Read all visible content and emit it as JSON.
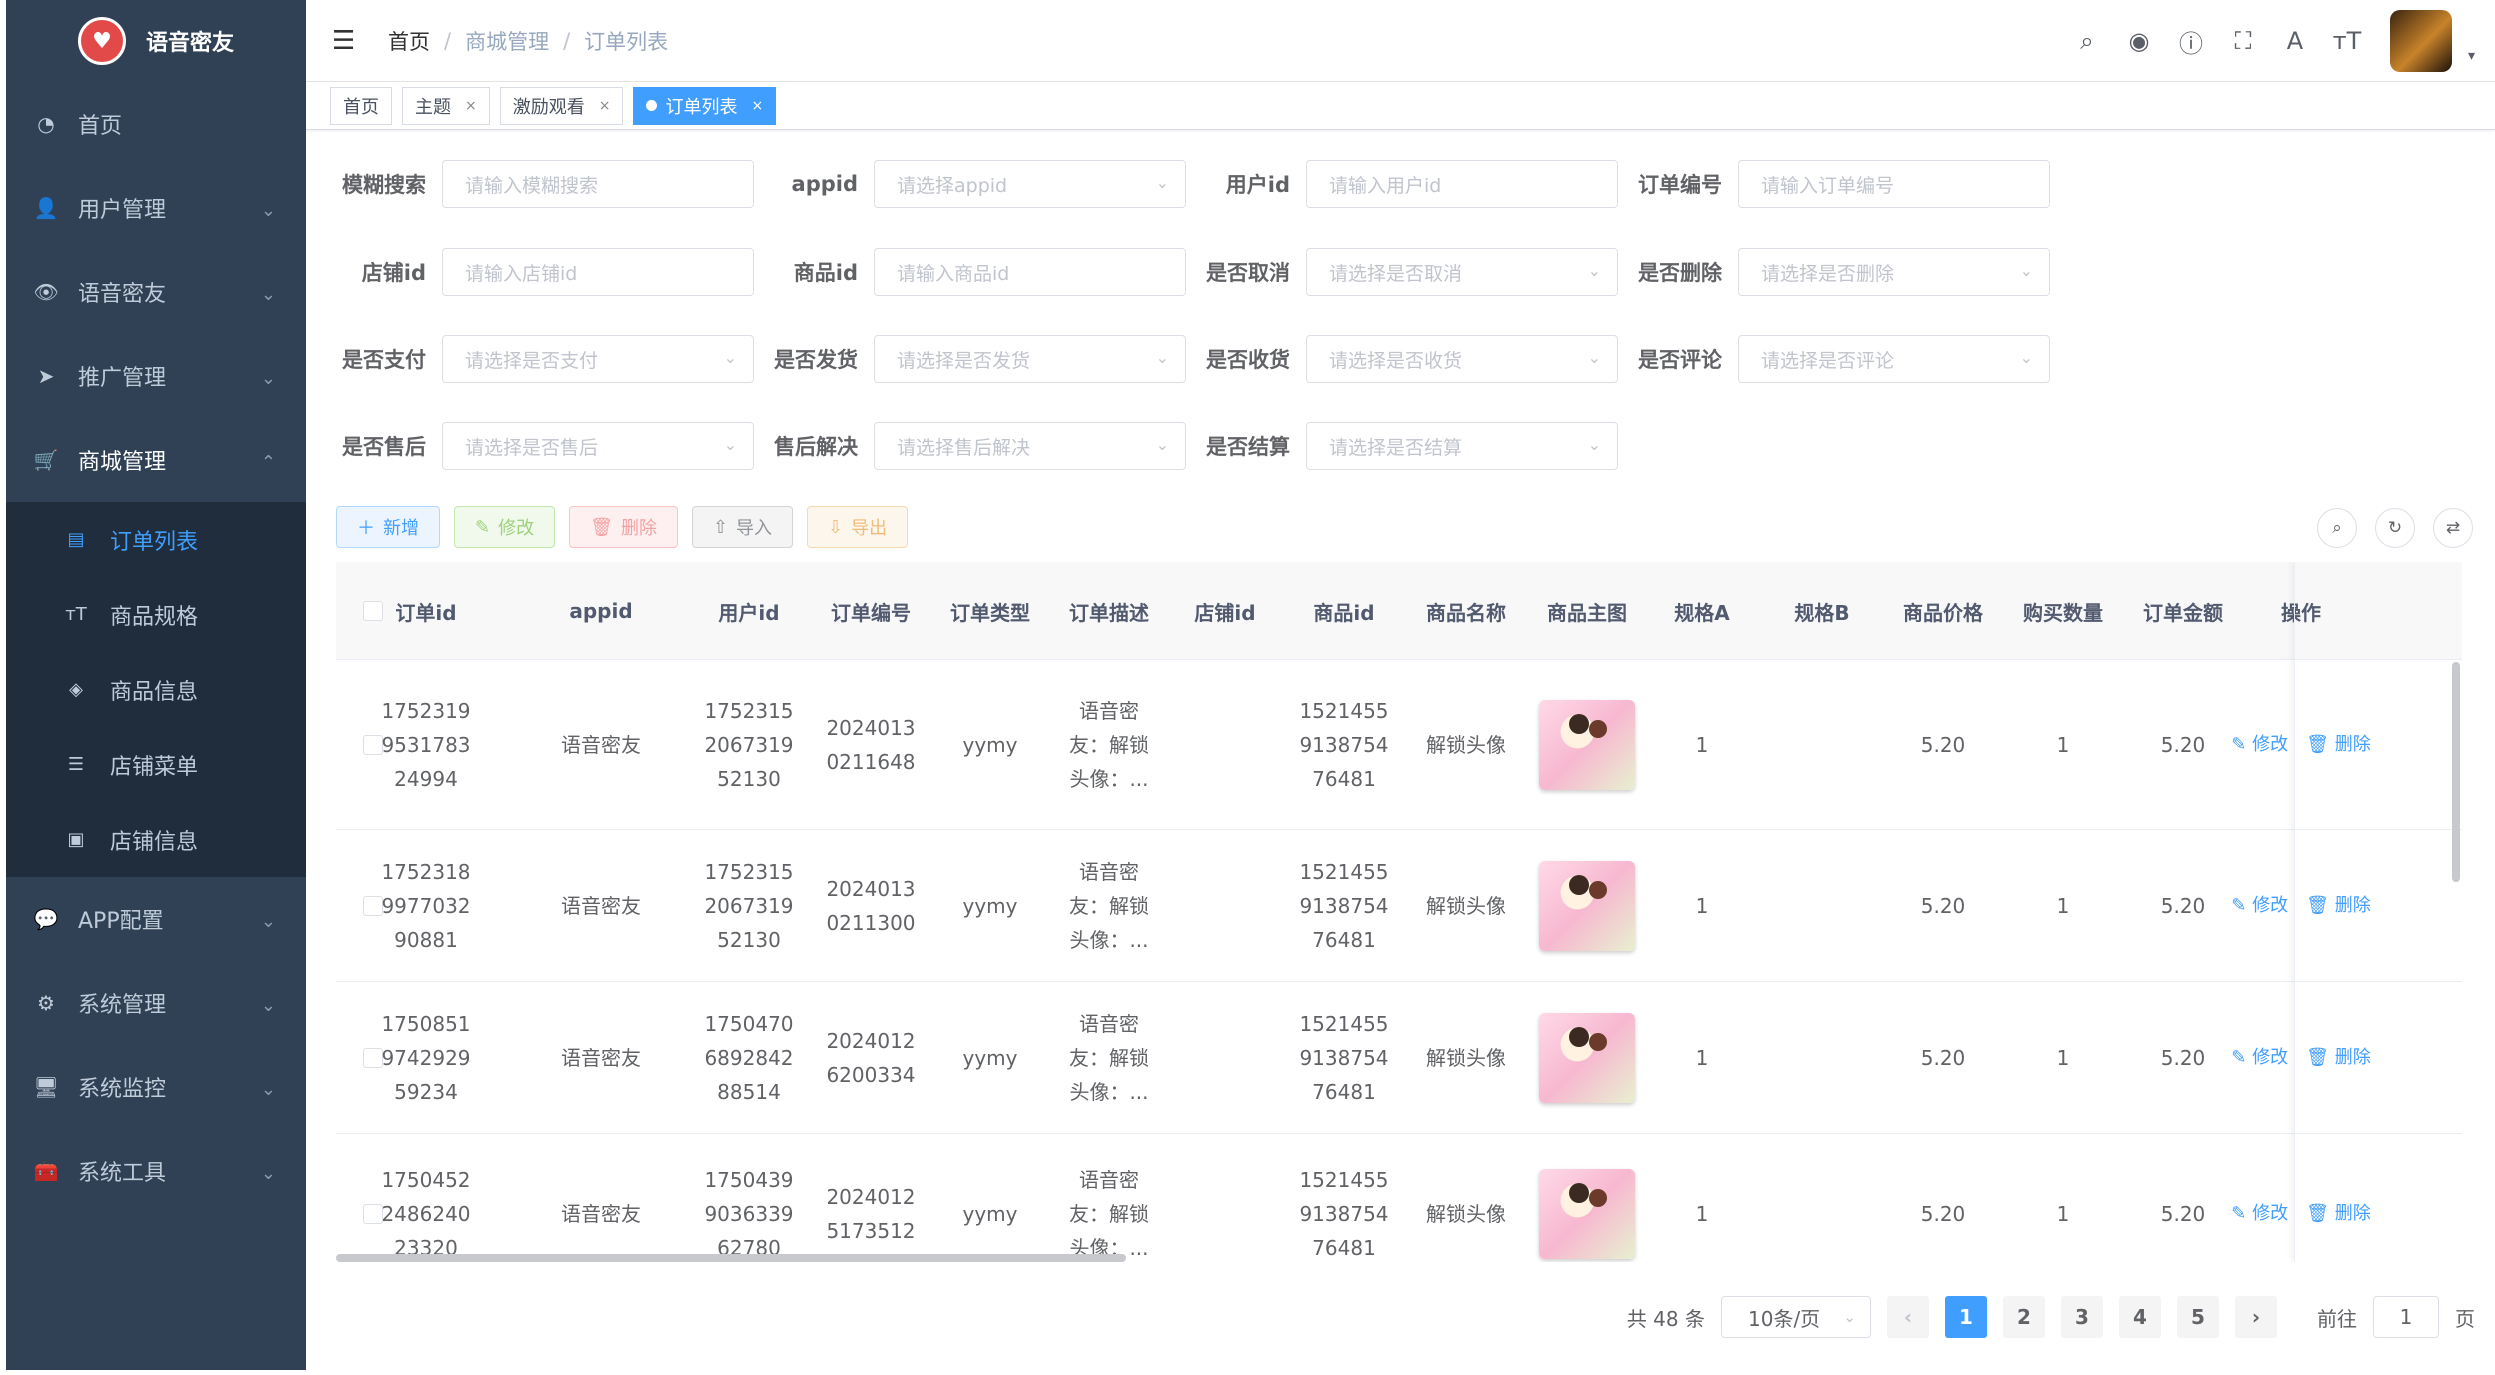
{
  "app": {
    "title": "语音密友",
    "logo_icon": "heart-icon"
  },
  "sidebar": {
    "items": [
      {
        "label": "首页",
        "icon": "dashboard-icon"
      },
      {
        "label": "用户管理",
        "icon": "user-icon"
      },
      {
        "label": "语音密友",
        "icon": "eye-icon"
      },
      {
        "label": "推广管理",
        "icon": "send-icon"
      },
      {
        "label": "商城管理",
        "icon": "cart-icon"
      },
      {
        "label": "APP配置",
        "icon": "wechat-icon"
      },
      {
        "label": "系统管理",
        "icon": "gear-icon"
      },
      {
        "label": "系统监控",
        "icon": "monitor-icon"
      },
      {
        "label": "系统工具",
        "icon": "toolbox-icon"
      }
    ],
    "submenu": [
      {
        "label": "订单列表",
        "icon": "document-icon",
        "active": true
      },
      {
        "label": "商品规格",
        "icon": "text-size-icon"
      },
      {
        "label": "商品信息",
        "icon": "layers-icon"
      },
      {
        "label": "店铺菜单",
        "icon": "list-icon"
      },
      {
        "label": "店铺信息",
        "icon": "card-icon"
      }
    ]
  },
  "breadcrumb": [
    "首页",
    "商城管理",
    "订单列表"
  ],
  "tags": [
    "首页",
    "主题",
    "激励观看",
    "订单列表"
  ],
  "filters": [
    [
      {
        "label": "模糊搜索",
        "placeholder": "请输入模糊搜索",
        "select": false
      },
      {
        "label": "appid",
        "placeholder": "请选择appid",
        "select": true
      },
      {
        "label": "用户id",
        "placeholder": "请输入用户id",
        "select": false
      },
      {
        "label": "订单编号",
        "placeholder": "请输入订单编号",
        "select": false
      }
    ],
    [
      {
        "label": "店铺id",
        "placeholder": "请输入店铺id",
        "select": false
      },
      {
        "label": "商品id",
        "placeholder": "请输入商品id",
        "select": false
      },
      {
        "label": "是否取消",
        "placeholder": "请选择是否取消",
        "select": true
      },
      {
        "label": "是否删除",
        "placeholder": "请选择是否删除",
        "select": true
      }
    ],
    [
      {
        "label": "是否支付",
        "placeholder": "请选择是否支付",
        "select": true
      },
      {
        "label": "是否发货",
        "placeholder": "请选择是否发货",
        "select": true
      },
      {
        "label": "是否收货",
        "placeholder": "请选择是否收货",
        "select": true
      },
      {
        "label": "是否评论",
        "placeholder": "请选择是否评论",
        "select": true
      }
    ],
    [
      {
        "label": "是否售后",
        "placeholder": "请选择是否售后",
        "select": true
      },
      {
        "label": "售后解决",
        "placeholder": "请选择售后解决",
        "select": true
      },
      {
        "label": "是否结算",
        "placeholder": "请选择是否结算",
        "select": true
      }
    ]
  ],
  "toolbar": {
    "add": "新增",
    "edit": "修改",
    "delete": "删除",
    "import": "导入",
    "export": "导出"
  },
  "table": {
    "columns": [
      "订单id",
      "appid",
      "用户id",
      "订单编号",
      "订单类型",
      "订单描述",
      "店铺id",
      "商品id",
      "商品名称",
      "商品主图",
      "规格A",
      "规格B",
      "商品价格",
      "购买数量",
      "订单金额",
      "操作"
    ],
    "rows": [
      {
        "order_id": "1752319\n9531783\n24994",
        "appid": "语音密友",
        "user_id": "1752315\n2067319\n52130",
        "order_no": "2024013\n0211648",
        "type": "yymy",
        "desc": "语音密\n友：解锁\n头像：...",
        "shop_id": "",
        "goods_id": "1521455\n9138754\n76481",
        "goods_name": "解锁头像",
        "spec_a": "1",
        "spec_b": "",
        "price": "5.20",
        "qty": "1",
        "amount": "5.20"
      },
      {
        "order_id": "1752318\n9977032\n90881",
        "appid": "语音密友",
        "user_id": "1752315\n2067319\n52130",
        "order_no": "2024013\n0211300",
        "type": "yymy",
        "desc": "语音密\n友：解锁\n头像：...",
        "shop_id": "",
        "goods_id": "1521455\n9138754\n76481",
        "goods_name": "解锁头像",
        "spec_a": "1",
        "spec_b": "",
        "price": "5.20",
        "qty": "1",
        "amount": "5.20"
      },
      {
        "order_id": "1750851\n9742929\n59234",
        "appid": "语音密友",
        "user_id": "1750470\n6892842\n88514",
        "order_no": "2024012\n6200334",
        "type": "yymy",
        "desc": "语音密\n友：解锁\n头像：...",
        "shop_id": "",
        "goods_id": "1521455\n9138754\n76481",
        "goods_name": "解锁头像",
        "spec_a": "1",
        "spec_b": "",
        "price": "5.20",
        "qty": "1",
        "amount": "5.20"
      },
      {
        "order_id": "1750452\n2486240\n23320",
        "appid": "语音密友",
        "user_id": "1750439\n9036339\n62780",
        "order_no": "2024012\n5173512",
        "type": "yymy",
        "desc": "语音密\n友：解锁\n头像：...",
        "shop_id": "",
        "goods_id": "1521455\n9138754\n76481",
        "goods_name": "解锁头像",
        "spec_a": "1",
        "spec_b": "",
        "price": "5.20",
        "qty": "1",
        "amount": "5.20"
      }
    ],
    "row_actions": {
      "edit": "修改",
      "delete": "删除"
    }
  },
  "pagination": {
    "total": "共 48 条",
    "page_size": "10条/页",
    "pages": [
      "1",
      "2",
      "3",
      "4",
      "5"
    ],
    "current": "1",
    "goto_label": "前往",
    "goto_value": "1",
    "page_suffix": "页"
  },
  "colors": {
    "primary": "#409eff",
    "sidebar_bg": "#304156",
    "submenu_bg": "#1f2d3d"
  }
}
